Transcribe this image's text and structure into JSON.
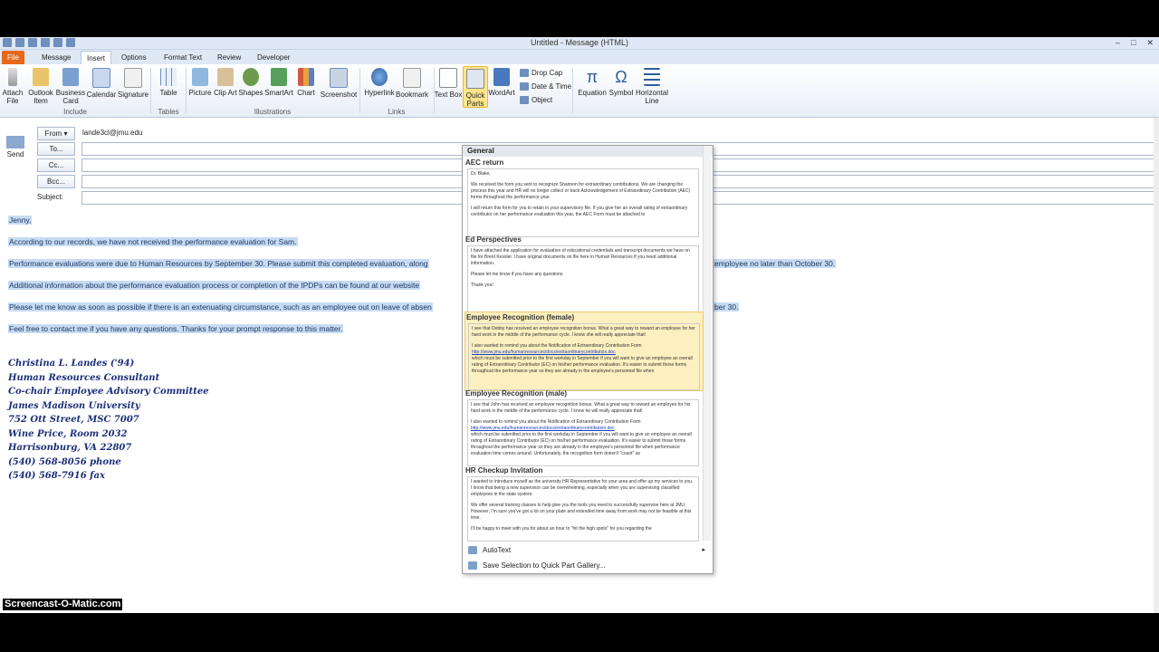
{
  "window": {
    "title": "Untitled - Message (HTML)"
  },
  "tabs": [
    {
      "label": "File"
    },
    {
      "label": "Message"
    },
    {
      "label": "Insert"
    },
    {
      "label": "Options"
    },
    {
      "label": "Format Text"
    },
    {
      "label": "Review"
    },
    {
      "label": "Developer"
    }
  ],
  "ribbon": {
    "include": {
      "group": "Include",
      "attach_file": "Attach File",
      "outlook_item": "Outlook Item",
      "business_card": "Business Card",
      "calendar": "Calendar",
      "signature": "Signature"
    },
    "tables": {
      "group": "Tables",
      "table": "Table"
    },
    "illustrations": {
      "group": "Illustrations",
      "picture": "Picture",
      "clip_art": "Clip Art",
      "shapes": "Shapes",
      "smartart": "SmartArt",
      "chart": "Chart",
      "screenshot": "Screenshot"
    },
    "links": {
      "group": "Links",
      "hyperlink": "Hyperlink",
      "bookmark": "Bookmark"
    },
    "text": {
      "text_box": "Text Box",
      "quick_parts": "Quick Parts",
      "wordart": "WordArt",
      "drop_cap": "Drop Cap",
      "date_time": "Date & Time",
      "object": "Object"
    },
    "symbols": {
      "equation": "Equation",
      "symbol": "Symbol",
      "horizontal_line": "Horizontal Line"
    }
  },
  "header": {
    "send": "Send",
    "from_label": "From",
    "from_value": "lande3cl@jmu.edu",
    "to_label": "To...",
    "cc_label": "Cc...",
    "bcc_label": "Bcc...",
    "subject_label": "Subject:"
  },
  "body": {
    "greeting": "Jenny,",
    "line1": "According to our records, we have not received the performance evaluation for Sam.",
    "line2a": "Performance evaluations were due to Human Resources by September 30.  Please submit this completed evaluation, along",
    "line2b": "employee no later than October 30.",
    "line3": "Additional information about the performance evaluation process or completion of the IPDPs can be found at our website",
    "line4a": "Please let me know as soon as possible if there is an extenuating circumstance, such as an employee out on leave of absen",
    "line4b": "ber 30.",
    "line5": "Feel free to contact me if you have any questions.  Thanks for your prompt response to this matter.",
    "signature": [
      "Christina L. Landes ('94)",
      "Human Resources Consultant",
      "Co-chair Employee Advisory Committee",
      "James Madison University",
      "752 Ott Street, MSC 7007",
      "Wine Price, Room 2032",
      "Harrisonburg, VA  22807",
      "(540) 568-8056  phone",
      "(540) 568-7916  fax"
    ]
  },
  "quick_parts": {
    "section": "General",
    "entries": [
      {
        "name": "AEC return",
        "preview": [
          "Dr. Blake,",
          "We received the form you sent to recognize Shannon for extraordinary contributions. We are changing the process this year and HR will no longer collect or track Acknowledgement of Extraordinary Contribution (AEC) forms throughout the performance year.",
          "I will return this form for you to retain in your supervisory file. If you give her an overall rating of extraordinary contributor on her performance evaluation this year, the AEC Form must be attached to"
        ]
      },
      {
        "name": "Ed Perspectives",
        "preview": [
          "I have attached the application for evaluation of educational credentials and transcript documents we have on file for Brent Kessler. I have original documents on file here in Human Resources if you need additional information.",
          "Please let me know if you have any questions.",
          "Thank you!"
        ]
      },
      {
        "name": "Employee Recognition (female)",
        "preview": [
          "I see that Debby has received an employee recognition bonus.  What a great way to reward an employee for her hard work in the middle of the performance cycle. I know she will really appreciate that!",
          "I also wanted to remind you about the Notification of Extraordinary Contribution Form",
          "http://www.jmu.edu/humanresources/docs/extraordinarycontribution.doc",
          "which must be submitted prior to the first workday in September if you will want to give an employee an overall rating of Extraordinary Contributor (EC) on his/her performance evaluation.  It's easier to submit those forms throughout the performance year so they are already in the employee's personnel file when"
        ]
      },
      {
        "name": "Employee Recognition (male)",
        "preview": [
          "I see that John has received an employee recognition bonus.  What a great way to reward an employee for his hard work in the middle of the performance cycle. I know he will really appreciate that!",
          "I also wanted to remind you about the Notification of Extraordinary Contribution Form",
          "http://www.jmu.edu/humanresources/docs/extraordinarycontribution.doc",
          "which must be submitted prior to the first workday in September if you will want to give an employee an overall rating of Extraordinary Contributor (EC) on his/her performance evaluation.  It's easier to submit those forms throughout the performance year so they are already in the employee's personnel file when performance evaluation time comes around.  Unfortunately, the recognition form doesn't \"count\" as"
        ]
      },
      {
        "name": "HR Checkup Invitation",
        "preview": [
          "I wanted to introduce myself as the university HR Representative for your area and offer up my services to you. I know that being a new supervisor can be overwhelming, especially when you are supervising classified employees in the state system.",
          "We offer several training classes to help give you the tools you need to successfully supervise here at JMU. However, I'm sure you've got a lot on your plate and extended time away from work may not be feasible at this time.",
          "I'll be happy to meet with you for about an hour to \"hit the high spots\" for you regarding the"
        ]
      }
    ],
    "autotext": "AutoText",
    "save_selection": "Save Selection to Quick Part Gallery..."
  },
  "watermark": "Screencast-O-Matic.com"
}
